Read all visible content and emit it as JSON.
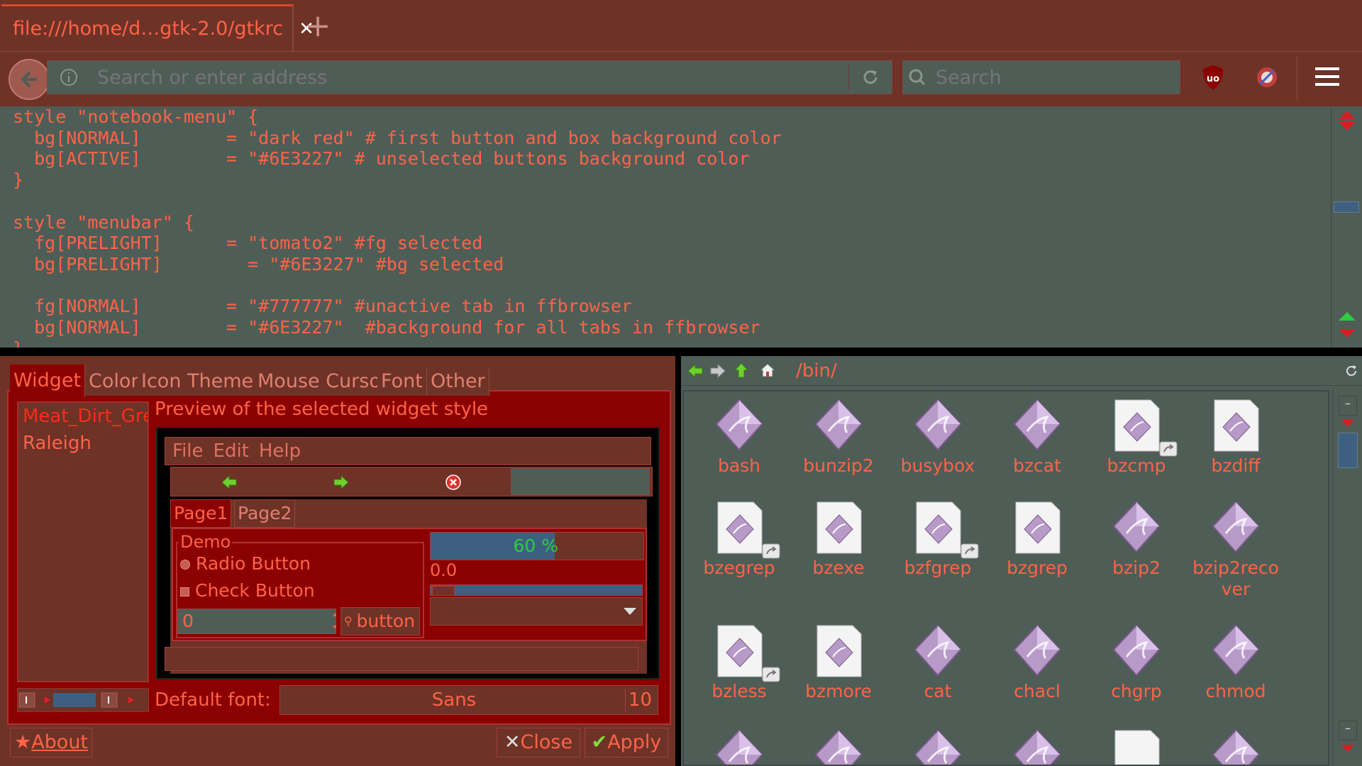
{
  "browser": {
    "tab_title": "file:///home/d…gtk-2.0/gtkrc",
    "url_placeholder": "Search or enter address",
    "search_placeholder": "Search",
    "code_lines": [
      "style \"notebook-menu\" {",
      "  bg[NORMAL]        = \"dark red\" # first button and box background color",
      "  bg[ACTIVE]        = \"#6E3227\" # unselected buttons background color",
      "}",
      "",
      "style \"menubar\" {",
      "  fg[PRELIGHT]      = \"tomato2\" #fg selected",
      "  bg[PRELIGHT]        = \"#6E3227\" #bg selected",
      "",
      "  fg[NORMAL]        = \"#777777\" #unactive tab in ffbrowser",
      "  bg[NORMAL]        = \"#6E3227\"  #background for all tabs in ffbrowser",
      "}"
    ]
  },
  "theme_dialog": {
    "tabs": [
      "Widget",
      "Color",
      "Icon Theme",
      "Mouse Cursor",
      "Font",
      "Other"
    ],
    "themes": [
      "Meat_Dirt_Green",
      "Raleigh"
    ],
    "preview_label": "Preview of the selected widget style",
    "preview": {
      "menus": [
        "File",
        "Edit",
        "Help"
      ],
      "tabs": [
        "Page1",
        "Page2"
      ],
      "frame_label": "Demo",
      "radio_label": "Radio Button",
      "check_label": "Check Button",
      "spin_value": "0",
      "button_label": "button",
      "progress_text": "60 %",
      "progress": 0.6,
      "scale_value": "0.0"
    },
    "font_label": "Default font:",
    "font_name": "Sans",
    "font_size": "10",
    "about_label": "About",
    "close_label": "Close",
    "apply_label": "Apply"
  },
  "file_manager": {
    "path": "/bin/",
    "files": [
      {
        "name": "bash",
        "kind": "exec"
      },
      {
        "name": "bunzip2",
        "kind": "exec"
      },
      {
        "name": "busybox",
        "kind": "exec"
      },
      {
        "name": "bzcat",
        "kind": "exec"
      },
      {
        "name": "bzcmp",
        "kind": "script-link"
      },
      {
        "name": "bzdiff",
        "kind": "script"
      },
      {
        "name": "bzegrep",
        "kind": "script-link"
      },
      {
        "name": "bzexe",
        "kind": "script"
      },
      {
        "name": "bzfgrep",
        "kind": "script-link"
      },
      {
        "name": "bzgrep",
        "kind": "script"
      },
      {
        "name": "bzip2",
        "kind": "exec"
      },
      {
        "name": "bzip2recover",
        "kind": "exec"
      },
      {
        "name": "bzless",
        "kind": "script-link"
      },
      {
        "name": "bzmore",
        "kind": "script"
      },
      {
        "name": "cat",
        "kind": "exec"
      },
      {
        "name": "chacl",
        "kind": "exec"
      },
      {
        "name": "chgrp",
        "kind": "exec"
      },
      {
        "name": "chmod",
        "kind": "exec"
      },
      {
        "name": "",
        "kind": "exec"
      },
      {
        "name": "",
        "kind": "exec"
      },
      {
        "name": "",
        "kind": "exec"
      },
      {
        "name": "",
        "kind": "exec"
      },
      {
        "name": "",
        "kind": "blank"
      },
      {
        "name": "",
        "kind": "exec"
      }
    ]
  },
  "colors": {
    "dark_red": "#8B0000",
    "brown": "#6E3227",
    "tomato": "#ff6347",
    "slate": "#4f5d57"
  }
}
